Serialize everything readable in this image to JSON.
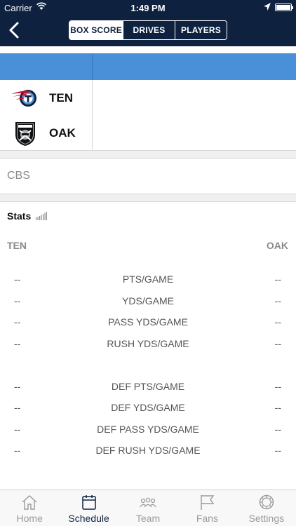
{
  "status": {
    "carrier": "Carrier",
    "time": "1:49 PM"
  },
  "nav": {
    "tabs": [
      "BOX SCORE",
      "DRIVES",
      "PLAYERS"
    ]
  },
  "teams": [
    {
      "abbr": "TEN",
      "logo": "titans-logo"
    },
    {
      "abbr": "OAK",
      "logo": "raiders-logo"
    }
  ],
  "network": "CBS",
  "stats": {
    "title": "Stats",
    "home_label": "TEN",
    "away_label": "OAK",
    "rows": [
      {
        "left": "--",
        "label": "PTS/GAME",
        "right": "--"
      },
      {
        "left": "--",
        "label": "YDS/GAME",
        "right": "--"
      },
      {
        "left": "--",
        "label": "PASS YDS/GAME",
        "right": "--"
      },
      {
        "left": "--",
        "label": "RUSH YDS/GAME",
        "right": "--"
      },
      {
        "left": "--",
        "label": "DEF PTS/GAME",
        "right": "--"
      },
      {
        "left": "--",
        "label": "DEF YDS/GAME",
        "right": "--"
      },
      {
        "left": "--",
        "label": "DEF PASS YDS/GAME",
        "right": "--"
      },
      {
        "left": "--",
        "label": "DEF RUSH YDS/GAME",
        "right": "--"
      }
    ]
  },
  "tabbar": {
    "items": [
      "Home",
      "Schedule",
      "Team",
      "Fans",
      "Settings"
    ],
    "active": "Schedule"
  },
  "colors": {
    "nav_bg": "#0e2240",
    "score_header": "#4a90d9"
  }
}
